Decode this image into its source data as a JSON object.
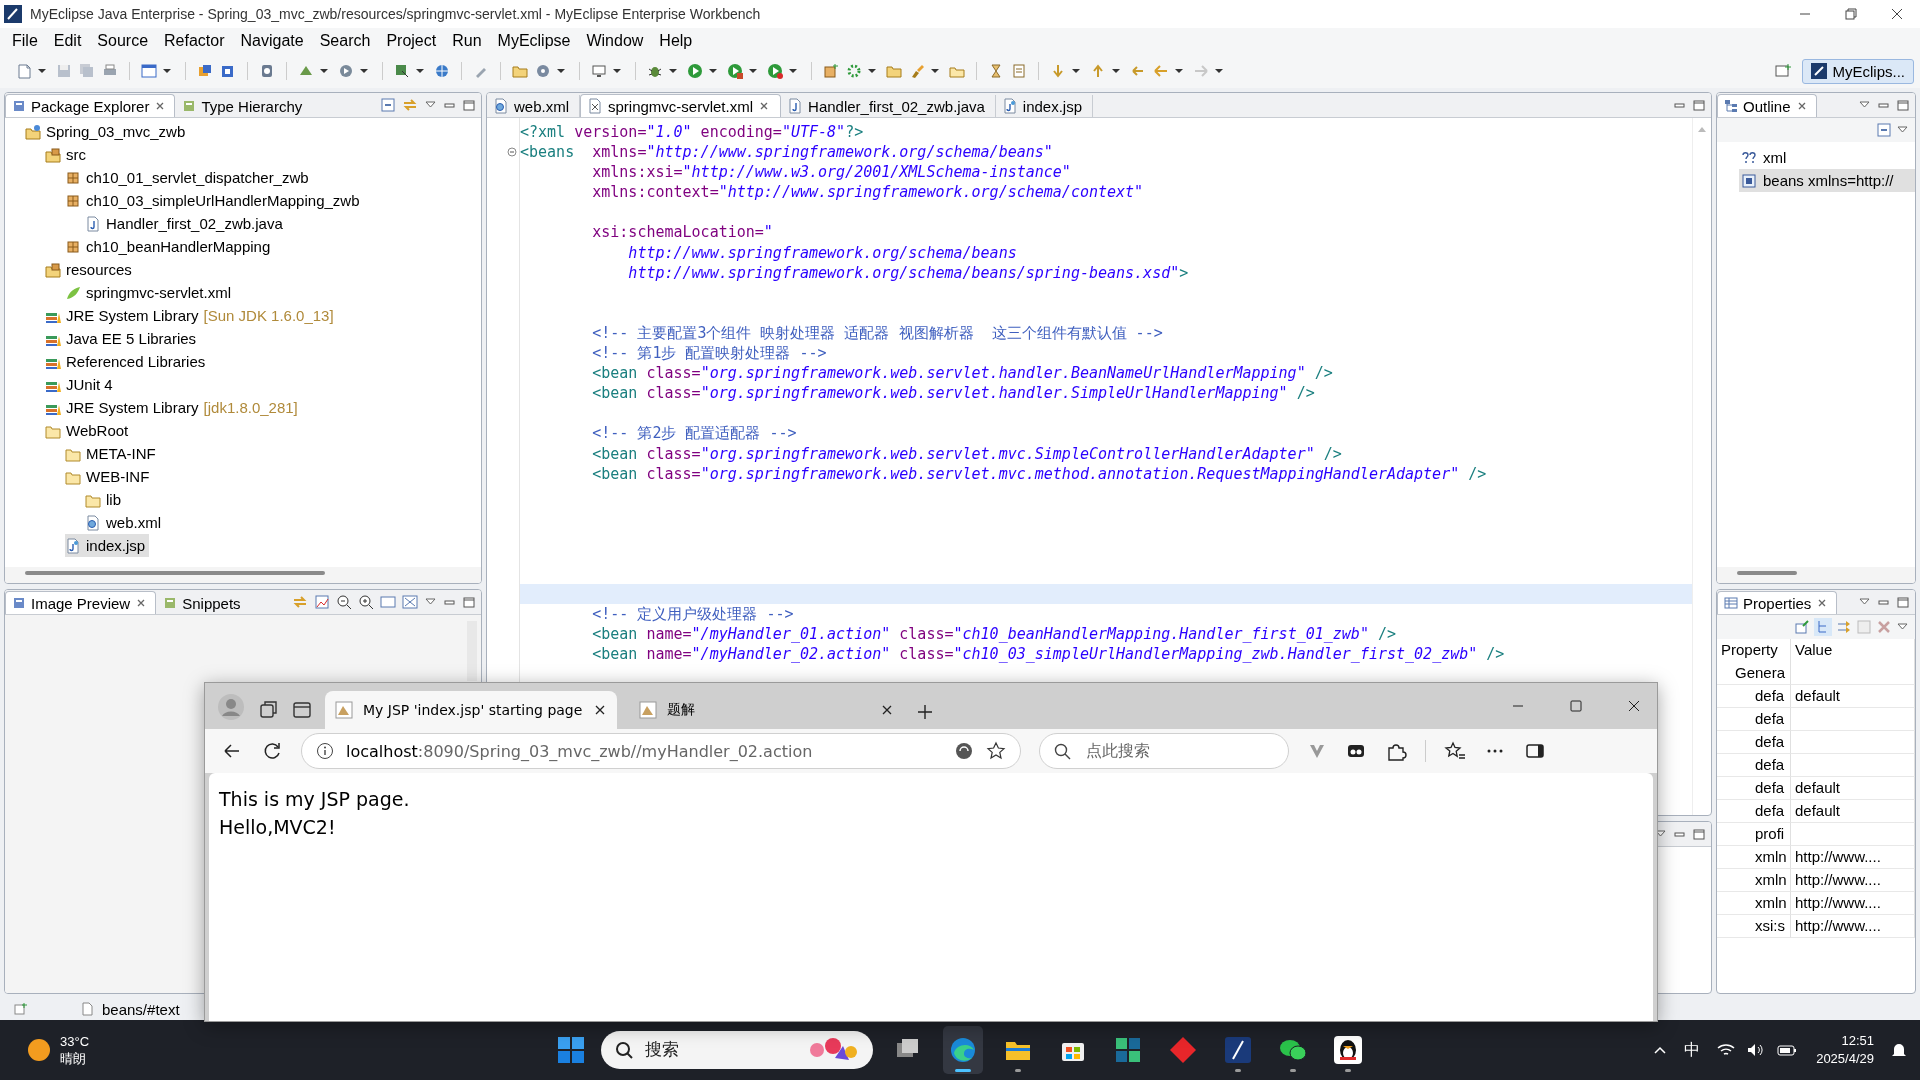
{
  "window": {
    "title": "MyEclipse Java Enterprise - Spring_03_mvc_zwb/resources/springmvc-servlet.xml - MyEclipse Enterprise Workbench"
  },
  "menu": [
    "File",
    "Edit",
    "Source",
    "Refactor",
    "Navigate",
    "Search",
    "Project",
    "Run",
    "MyEclipse",
    "Window",
    "Help"
  ],
  "perspective": {
    "label": "MyEclips...",
    "selected": true
  },
  "package_explorer": {
    "tabs": [
      {
        "label": "Package Explorer",
        "selected": true
      },
      {
        "label": "Type Hierarchy",
        "selected": false
      }
    ],
    "tree": [
      {
        "kind": "project",
        "label": "Spring_03_mvc_zwb",
        "selected": false,
        "children": [
          {
            "kind": "source-folder",
            "label": "src",
            "selected": false,
            "children": [
              {
                "kind": "package",
                "label": "ch10_01_servlet_dispatcher_zwb",
                "selected": false
              },
              {
                "kind": "package",
                "label": "ch10_03_simpleUrlHandlerMapping_zwb",
                "selected": false,
                "children": [
                  {
                    "kind": "java-file",
                    "label": "Handler_first_02_zwb.java",
                    "selected": false
                  }
                ]
              },
              {
                "kind": "package",
                "label": "ch10_beanHandlerMapping",
                "selected": false
              }
            ]
          },
          {
            "kind": "source-folder",
            "label": "resources",
            "selected": false,
            "children": [
              {
                "kind": "spring-file",
                "label": "springmvc-servlet.xml",
                "selected": false
              }
            ]
          },
          {
            "kind": "library",
            "label": "JRE System Library",
            "decoration": "[Sun JDK 1.6.0_13]",
            "selected": false
          },
          {
            "kind": "library",
            "label": "Java EE 5 Libraries",
            "selected": false
          },
          {
            "kind": "library",
            "label": "Referenced Libraries",
            "selected": false
          },
          {
            "kind": "library",
            "label": "JUnit 4",
            "selected": false
          },
          {
            "kind": "library",
            "label": "JRE System Library",
            "decoration": "[jdk1.8.0_281]",
            "selected": false
          },
          {
            "kind": "folder",
            "label": "WebRoot",
            "selected": false,
            "children": [
              {
                "kind": "folder",
                "label": "META-INF",
                "selected": false
              },
              {
                "kind": "folder",
                "label": "WEB-INF",
                "selected": false,
                "children": [
                  {
                    "kind": "folder",
                    "label": "lib",
                    "selected": false
                  },
                  {
                    "kind": "web-xml",
                    "label": "web.xml",
                    "selected": false
                  }
                ]
              },
              {
                "kind": "jsp-file",
                "label": "index.jsp",
                "selected": true
              }
            ]
          }
        ]
      }
    ]
  },
  "image_preview": {
    "tabs": [
      {
        "label": "Image Preview",
        "selected": true
      },
      {
        "label": "Snippets",
        "selected": false
      }
    ]
  },
  "editor": {
    "tabs": [
      {
        "kind": "web-xml",
        "label": "web.xml",
        "selected": false
      },
      {
        "kind": "xml-file",
        "label": "springmvc-servlet.xml",
        "selected": true
      },
      {
        "kind": "java-file",
        "label": "Handler_first_02_zwb.java",
        "selected": false
      },
      {
        "kind": "jsp-file",
        "label": "index.jsp",
        "selected": false
      }
    ],
    "lines": [
      {
        "current": false,
        "fold": false,
        "segments": [
          {
            "kind": "tag",
            "text": "<?xml"
          },
          {
            "kind": "attr",
            "text": " version="
          },
          {
            "kind": "value",
            "text": "\"1.0\""
          },
          {
            "kind": "attr",
            "text": " encoding="
          },
          {
            "kind": "value",
            "text": "\"UTF-8\""
          },
          {
            "kind": "tag",
            "text": "?>"
          }
        ]
      },
      {
        "current": false,
        "fold": true,
        "segments": [
          {
            "kind": "tag",
            "text": "<beans"
          },
          {
            "kind": "attr",
            "text": "  xmlns="
          },
          {
            "kind": "value",
            "text": "\"http://www.springframework.org/schema/beans\""
          }
        ]
      },
      {
        "current": false,
        "fold": false,
        "segments": [
          {
            "kind": "attr",
            "text": "        xmlns:xsi="
          },
          {
            "kind": "value",
            "text": "\"http://www.w3.org/2001/XMLSchema-instance\""
          }
        ]
      },
      {
        "current": false,
        "fold": false,
        "segments": [
          {
            "kind": "attr",
            "text": "        xmlns:context="
          },
          {
            "kind": "value",
            "text": "\"http://www.springframework.org/schema/context\""
          }
        ]
      },
      {
        "current": false,
        "fold": false
      },
      {
        "current": false,
        "fold": false,
        "segments": [
          {
            "kind": "attr",
            "text": "        xsi:schemaLocation="
          },
          {
            "kind": "value",
            "text": "\""
          }
        ]
      },
      {
        "current": false,
        "fold": false,
        "segments": [
          {
            "kind": "value",
            "text": "            http://www.springframework.org/schema/beans"
          }
        ]
      },
      {
        "current": false,
        "fold": false,
        "segments": [
          {
            "kind": "value",
            "text": "            http://www.springframework.org/schema/beans/spring-beans.xsd\""
          },
          {
            "kind": "tag",
            "text": ">"
          }
        ]
      },
      {
        "current": false,
        "fold": false
      },
      {
        "current": false,
        "fold": false
      },
      {
        "current": false,
        "fold": false,
        "segments": [
          {
            "kind": "comment",
            "text": "        <!-- 主要配置3个组件 映射处理器 适配器 视图解析器  这三个组件有默认值 -->"
          }
        ]
      },
      {
        "current": false,
        "fold": false,
        "segments": [
          {
            "kind": "comment",
            "text": "        <!-- 第1步 配置映射处理器 -->"
          }
        ]
      },
      {
        "current": false,
        "fold": false,
        "segments": [
          {
            "kind": "tag",
            "text": "        <bean"
          },
          {
            "kind": "attr",
            "text": " class="
          },
          {
            "kind": "value",
            "text": "\"org.springframework.web.servlet.handler.BeanNameUrlHandlerMapping\""
          },
          {
            "kind": "tag",
            "text": " />"
          }
        ]
      },
      {
        "current": false,
        "fold": false,
        "segments": [
          {
            "kind": "tag",
            "text": "        <bean"
          },
          {
            "kind": "attr",
            "text": " class="
          },
          {
            "kind": "value",
            "text": "\"org.springframework.web.servlet.handler.SimpleUrlHandlerMapping\""
          },
          {
            "kind": "tag",
            "text": " />"
          }
        ]
      },
      {
        "current": false,
        "fold": false
      },
      {
        "current": false,
        "fold": false,
        "segments": [
          {
            "kind": "comment",
            "text": "        <!-- 第2步 配置适配器 -->"
          }
        ]
      },
      {
        "current": false,
        "fold": false,
        "segments": [
          {
            "kind": "tag",
            "text": "        <bean"
          },
          {
            "kind": "attr",
            "text": " class="
          },
          {
            "kind": "value",
            "text": "\"org.springframework.web.servlet.mvc.SimpleControllerHandlerAdapter\""
          },
          {
            "kind": "tag",
            "text": " />"
          }
        ]
      },
      {
        "current": false,
        "fold": false,
        "segments": [
          {
            "kind": "tag",
            "text": "        <bean"
          },
          {
            "kind": "attr",
            "text": " class="
          },
          {
            "kind": "value",
            "text": "\"org.springframework.web.servlet.mvc.method.annotation.RequestMappingHandlerAdapter\""
          },
          {
            "kind": "tag",
            "text": " />"
          }
        ]
      },
      {
        "current": false,
        "fold": false
      },
      {
        "current": false,
        "fold": false
      },
      {
        "current": false,
        "fold": false
      },
      {
        "current": false,
        "fold": false
      },
      {
        "current": false,
        "fold": false
      },
      {
        "current": true,
        "fold": false
      },
      {
        "current": false,
        "fold": false,
        "segments": [
          {
            "kind": "comment",
            "text": "        <!-- 定义用户级处理器 -->"
          }
        ]
      },
      {
        "current": false,
        "fold": false,
        "segments": [
          {
            "kind": "tag",
            "text": "        <bean"
          },
          {
            "kind": "attr",
            "text": " name="
          },
          {
            "kind": "value",
            "text": "\"/myHandler_01.action\""
          },
          {
            "kind": "attr",
            "text": " class="
          },
          {
            "kind": "value",
            "text": "\"ch10_beanHandlerMapping.Handler_first_01_zwb\""
          },
          {
            "kind": "tag",
            "text": " />"
          }
        ]
      },
      {
        "current": false,
        "fold": false,
        "segments": [
          {
            "kind": "tag",
            "text": "        <bean"
          },
          {
            "kind": "attr",
            "text": " name="
          },
          {
            "kind": "value",
            "text": "\"/myHandler_02.action\""
          },
          {
            "kind": "attr",
            "text": " class="
          },
          {
            "kind": "value",
            "text": "\"ch10_03_simpleUrlHandlerMapping_zwb.Handler_first_02_zwb\""
          },
          {
            "kind": "tag",
            "text": " />"
          }
        ]
      }
    ]
  },
  "outline": {
    "title": "Outline",
    "items": [
      {
        "kind": "processing-instruction",
        "label": "xml",
        "selected": false
      },
      {
        "kind": "element",
        "label": "beans xmlns=http://",
        "selected": true
      }
    ]
  },
  "properties": {
    "title": "Properties",
    "columns": [
      "Property",
      "Value"
    ],
    "rows": [
      {
        "kind": "category",
        "property": "Genera"
      },
      {
        "kind": "property",
        "property": "defa",
        "value": "default"
      },
      {
        "kind": "property",
        "property": "defa"
      },
      {
        "kind": "property",
        "property": "defa"
      },
      {
        "kind": "property",
        "property": "defa"
      },
      {
        "kind": "property",
        "property": "defa",
        "value": "default"
      },
      {
        "kind": "property",
        "property": "defa",
        "value": "default"
      },
      {
        "kind": "property",
        "property": "profi"
      },
      {
        "kind": "property",
        "property": "xmln",
        "value": "http://www...."
      },
      {
        "kind": "property",
        "property": "xmln",
        "value": "http://www...."
      },
      {
        "kind": "property",
        "property": "xmln",
        "value": "http://www...."
      },
      {
        "kind": "property",
        "property": "xsi:s",
        "value": "http://www...."
      }
    ]
  },
  "status_bar": {
    "text": "beans/#text"
  },
  "browser": {
    "tabs": [
      {
        "title": "My JSP 'index.jsp' starting page",
        "selected": true
      },
      {
        "title": "题解",
        "selected": false
      }
    ],
    "address": {
      "host": "localhost",
      "rest": ":8090/Spring_03_mvc_zwb//myHandler_02.action"
    },
    "search": {
      "placeholder": "点此搜索"
    },
    "content": [
      "This is my JSP page.",
      "Hello,MVC2!"
    ]
  },
  "taskbar": {
    "weather": {
      "temperature": "33°C",
      "condition": "晴朗"
    },
    "search": {
      "placeholder": "搜索"
    },
    "apps": [
      {
        "kind": "task-view",
        "running": false,
        "selected": false
      },
      {
        "kind": "edge",
        "running": true,
        "selected": true
      },
      {
        "kind": "explorer",
        "running": true,
        "selected": false
      },
      {
        "kind": "store",
        "running": false,
        "selected": false
      },
      {
        "kind": "tiles",
        "running": false,
        "selected": false
      },
      {
        "kind": "diamond",
        "running": false,
        "selected": false
      },
      {
        "kind": "pen",
        "running": true,
        "selected": false
      },
      {
        "kind": "chat",
        "running": true,
        "selected": false
      },
      {
        "kind": "penguin",
        "running": true,
        "selected": false
      }
    ],
    "ime": "中",
    "time": "12:51",
    "date": "2025/4/29"
  }
}
